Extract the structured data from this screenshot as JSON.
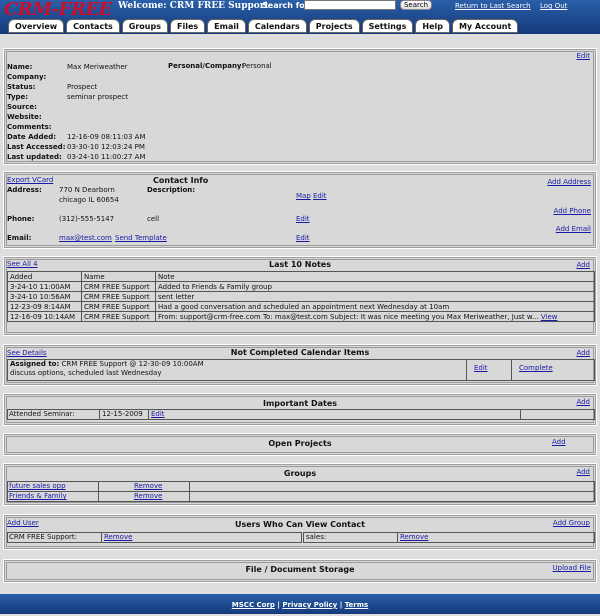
{
  "header": {
    "logo": "CRM-FREE",
    "welcome": "Welcome: CRM FREE Support",
    "search_label": "Search for:",
    "search_value": "",
    "search_button": "Search",
    "return_link": "Return to Last Search",
    "logout_link": "Log Out"
  },
  "tabs": [
    "Overview",
    "Contacts",
    "Groups",
    "Files",
    "Email",
    "Calendars",
    "Projects",
    "Settings",
    "Help",
    "My Account"
  ],
  "details": {
    "edit": "Edit",
    "labels": [
      "Name:",
      "Company:",
      "Status:",
      "Type:",
      "Source:",
      "Website:",
      "Comments:",
      "Date Added:",
      "Last Accessed:",
      "Last updated:"
    ],
    "values": [
      "Max Meriweather",
      "",
      "Prospect",
      "seminar prospect",
      "",
      "",
      "",
      "12-16-09 08:11:03 AM",
      "03-30-10 12:03:24 PM",
      "03-24-10 11:00:27 AM"
    ],
    "pc_label": "Personal/Company:",
    "pc_value": "Personal"
  },
  "contact": {
    "export": "Export VCard",
    "title": "Contact Info",
    "add_address": "Add Address",
    "address_label": "Address:",
    "address_line1": "770 N Dearborn",
    "address_line2": "chicago IL 60654",
    "description_label": "Description:",
    "map": "Map",
    "edit": "Edit",
    "add_phone": "Add Phone",
    "phone_label": "Phone:",
    "phone_value": "(312)-555-5147",
    "phone_desc": "cell",
    "add_email": "Add Email",
    "email_label": "Email:",
    "email_value": "max@test.com",
    "send_template": "Send Template"
  },
  "notes": {
    "see_all": "See All 4",
    "title": "Last 10 Notes",
    "add": "Add",
    "headers": [
      "Added",
      "Name",
      "Note"
    ],
    "rows": [
      [
        "3-24-10 11:00AM",
        "CRM FREE Support",
        "Added to Friends & Family group"
      ],
      [
        "3-24-10 10:56AM",
        "CRM FREE Support",
        "sent letter"
      ],
      [
        "12-23-09 8:14AM",
        "CRM FREE Support",
        "Had a good conversation and scheduled an appointment next Wednesday at 10am"
      ],
      [
        "12-16-09 10:14AM",
        "CRM FREE Support",
        "From: support@crm-free.com To: max@test.com Subject: It was nice meeting you Max Meriweather, Just w..."
      ]
    ],
    "view": "View"
  },
  "calendar": {
    "see_details": "See Details",
    "title": "Not Completed Calendar Items",
    "add": "Add",
    "assigned_label": "Assigned to:",
    "assigned_value": "CRM FREE Support @ 12-30-09 10:00AM",
    "description": "discuss options, scheduled last Wednesday",
    "edit": "Edit",
    "complete": "Complete"
  },
  "dates": {
    "title": "Important Dates",
    "add": "Add",
    "label": "Attended Seminar:",
    "value": "12-15-2009",
    "edit": "Edit"
  },
  "projects": {
    "title": "Open Projects",
    "add": "Add"
  },
  "groups": {
    "title": "Groups",
    "add": "Add",
    "items": [
      "future sales opp",
      "Friends & Family"
    ],
    "remove": "Remove"
  },
  "viewers": {
    "add_user": "Add User",
    "title": "Users Who Can View Contact",
    "add_group": "Add Group",
    "user": "CRM FREE Support:",
    "group": "sales:",
    "remove": "Remove"
  },
  "files": {
    "title": "File / Document Storage",
    "upload": "Upload File"
  },
  "footer": {
    "corp": "MSCC Corp",
    "sep": "|",
    "privacy": "Privacy Policy",
    "terms": "Terms"
  }
}
